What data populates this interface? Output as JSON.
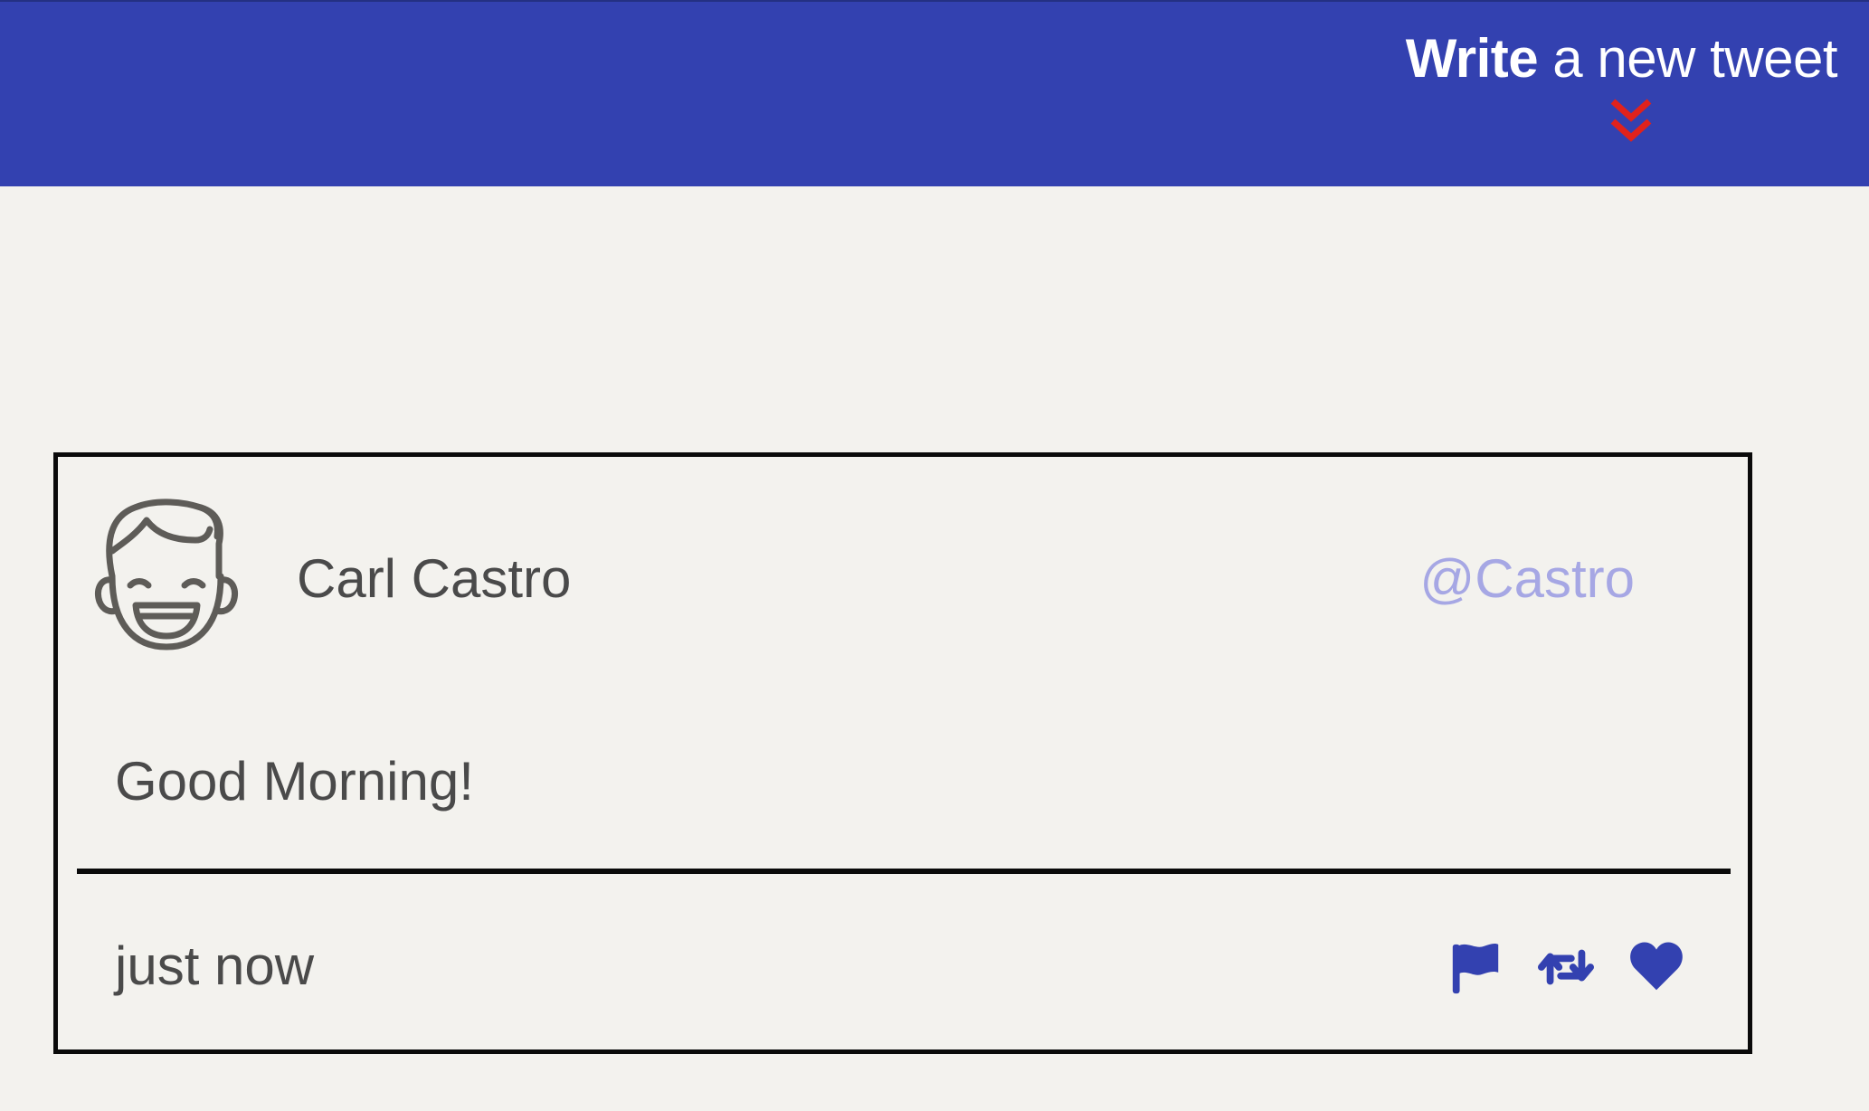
{
  "header": {
    "compose_strong": "Write",
    "compose_rest": " a new tweet",
    "chevron_icon": "double-chevron-down-icon",
    "background_color": "#3341b0",
    "chevron_color": "#e0221c"
  },
  "tweet": {
    "author_name": "Carl Castro",
    "author_handle": "@Castro",
    "text": "Good Morning!",
    "timestamp": "just now",
    "avatar_icon": "smiling-face-avatar-icon",
    "actions": [
      {
        "icon": "flag-icon"
      },
      {
        "icon": "retweet-icon"
      },
      {
        "icon": "heart-icon"
      }
    ],
    "accent_color": "#3341b0",
    "handle_color": "#a6a7e4"
  }
}
